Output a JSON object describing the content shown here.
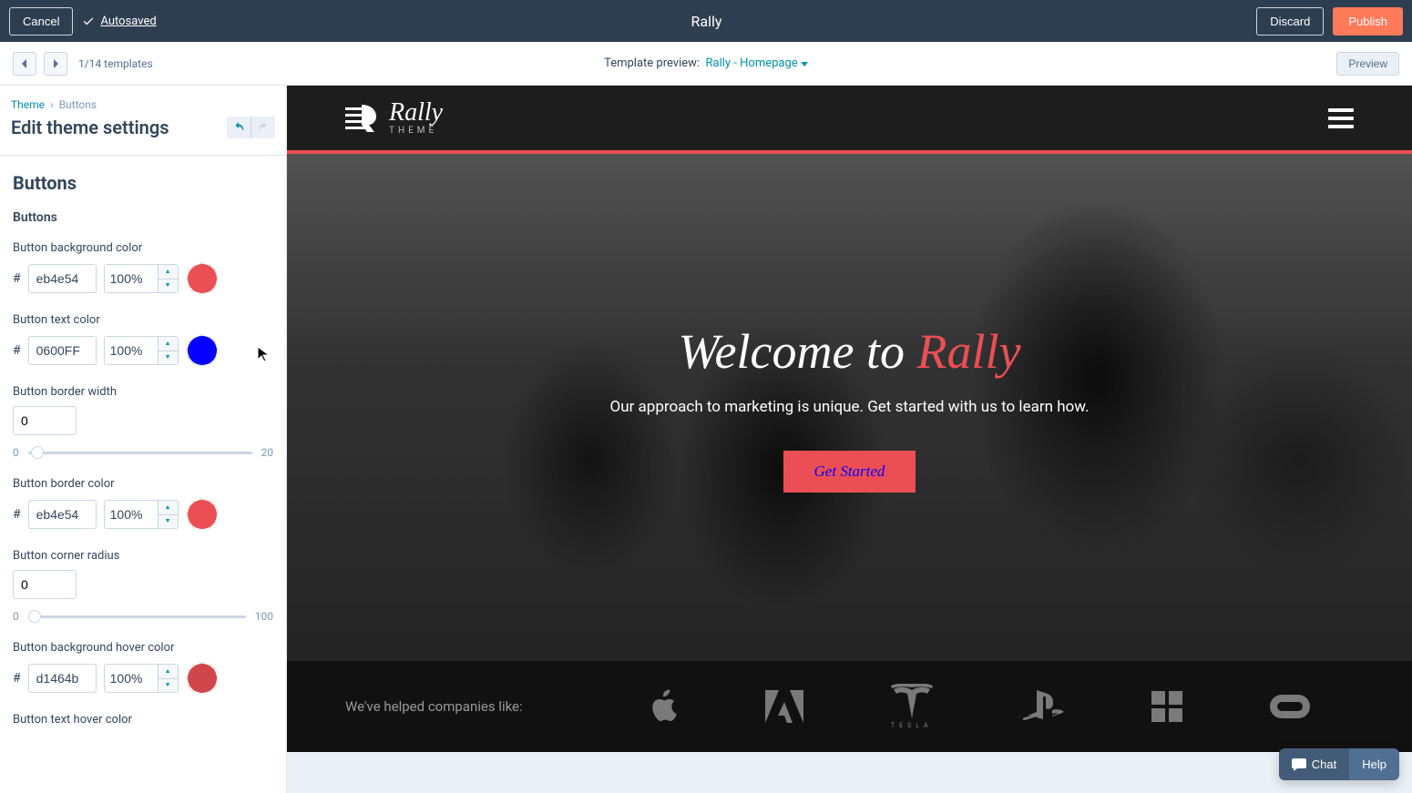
{
  "topbar": {
    "cancel": "Cancel",
    "autosaved": "Autosaved",
    "title": "Rally",
    "discard": "Discard",
    "publish": "Publish"
  },
  "subbar": {
    "templates_count": "1/14 templates",
    "preview_label": "Template preview:",
    "template_name": "Rally - Homepage",
    "preview_btn": "Preview"
  },
  "sidebar": {
    "breadcrumb_root": "Theme",
    "breadcrumb_current": "Buttons",
    "title": "Edit theme settings",
    "section": "Buttons",
    "subheader": "Buttons",
    "fields": {
      "bg_color": {
        "label": "Button background color",
        "hex": "eb4e54",
        "opacity": "100%",
        "swatch": "#eb4e54"
      },
      "text_color": {
        "label": "Button text color",
        "hex": "0600FF",
        "opacity": "100%",
        "swatch": "#0600FF"
      },
      "border_width": {
        "label": "Button border width",
        "value": "0",
        "min": "0",
        "max": "20"
      },
      "border_color": {
        "label": "Button border color",
        "hex": "eb4e54",
        "opacity": "100%",
        "swatch": "#eb4e54"
      },
      "corner_radius": {
        "label": "Button corner radius",
        "value": "0",
        "min": "0",
        "max": "100"
      },
      "bg_hover": {
        "label": "Button background hover color",
        "hex": "d1464b",
        "opacity": "100%",
        "swatch": "#d1464b"
      },
      "text_hover": {
        "label": "Button text hover color"
      }
    }
  },
  "preview_site": {
    "brand": "Rally",
    "brand_sub": "THEME",
    "hero_title_a": "Welcome to ",
    "hero_title_b": "Rally",
    "hero_sub": "Our approach to marketing is unique. Get started with us to learn how.",
    "cta": "Get Started",
    "cta_bg": "#eb4e54",
    "cta_color": "#0600FF",
    "companies_label": "We've helped companies like:"
  },
  "chat": {
    "chat_label": "Chat",
    "help_label": "Help"
  }
}
